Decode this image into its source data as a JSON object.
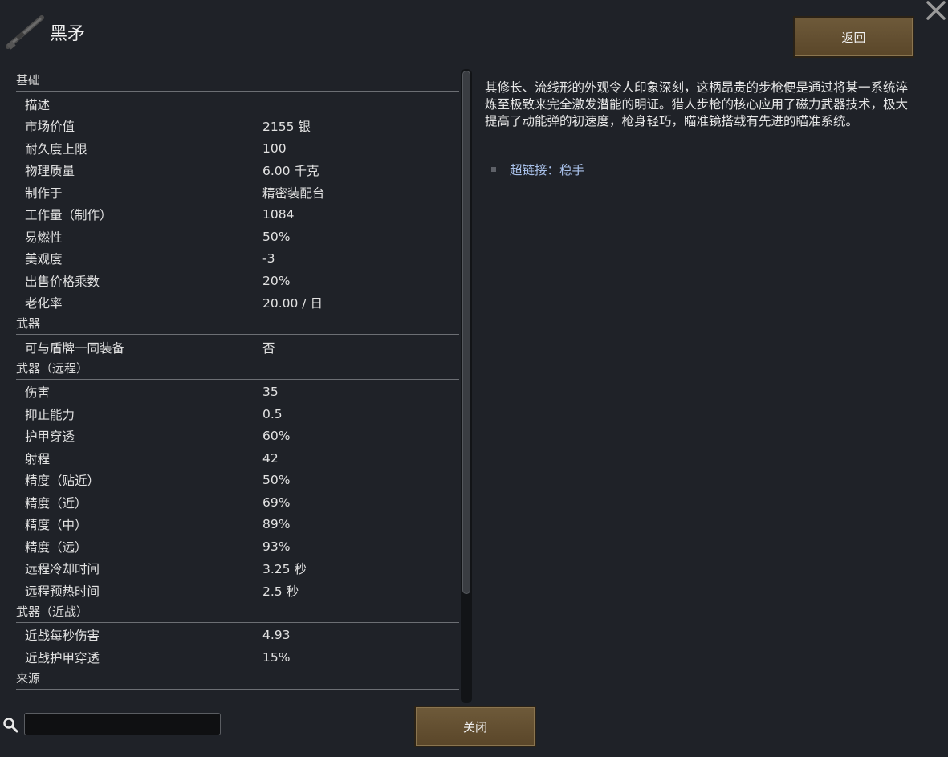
{
  "window": {
    "title": "黑矛",
    "back_label": "返回",
    "close_label": "关闭"
  },
  "stats": [
    {
      "category": "基础",
      "rows": [
        {
          "label": "描述",
          "value": ""
        },
        {
          "label": "市场价值",
          "value": "2155 银"
        },
        {
          "label": "耐久度上限",
          "value": "100"
        },
        {
          "label": "物理质量",
          "value": "6.00 千克"
        },
        {
          "label": "制作于",
          "value": "精密装配台"
        },
        {
          "label": "工作量（制作）",
          "value": "1084"
        },
        {
          "label": "易燃性",
          "value": "50%"
        },
        {
          "label": "美观度",
          "value": "-3"
        },
        {
          "label": "出售价格乘数",
          "value": "20%"
        },
        {
          "label": "老化率",
          "value": "20.00 / 日"
        }
      ]
    },
    {
      "category": "武器",
      "rows": [
        {
          "label": "可与盾牌一同装备",
          "value": "否"
        }
      ]
    },
    {
      "category": "武器（远程）",
      "rows": [
        {
          "label": "伤害",
          "value": "35"
        },
        {
          "label": "抑止能力",
          "value": "0.5"
        },
        {
          "label": "护甲穿透",
          "value": "60%"
        },
        {
          "label": "射程",
          "value": "42"
        },
        {
          "label": "精度（贴近）",
          "value": "50%"
        },
        {
          "label": "精度（近）",
          "value": "69%"
        },
        {
          "label": "精度（中）",
          "value": "89%"
        },
        {
          "label": "精度（远）",
          "value": "93%"
        },
        {
          "label": "远程冷却时间",
          "value": "3.25 秒"
        },
        {
          "label": "远程预热时间",
          "value": "2.5 秒"
        }
      ]
    },
    {
      "category": "武器（近战）",
      "rows": [
        {
          "label": "近战每秒伤害",
          "value": "4.93"
        },
        {
          "label": "近战护甲穿透",
          "value": "15%"
        }
      ]
    },
    {
      "category": "来源",
      "rows": []
    }
  ],
  "description": {
    "text": "其修长、流线形的外观令人印象深刻，这柄昂贵的步枪便是通过将某一系统淬炼至极致来完全激发潜能的明证。猎人步枪的核心应用了磁力武器技术，极大提高了动能弹的初速度，枪身轻巧，瞄准镜搭载有先进的瞄准系统。",
    "hyperlink": "超链接：稳手"
  },
  "search": {
    "value": "",
    "placeholder": ""
  },
  "scroll": {
    "visible_fraction": 0.83
  },
  "colors": {
    "background": "#1f2228",
    "button": "#6e5a3a",
    "hyperlink": "#a9c1ea"
  },
  "icons": [
    "spear-rifle-icon",
    "close-x-icon",
    "search-icon"
  ]
}
